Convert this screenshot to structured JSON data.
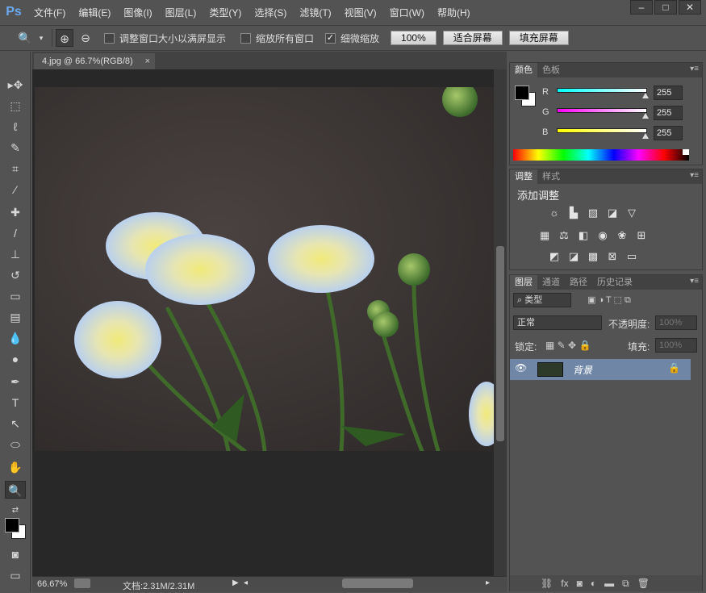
{
  "app": {
    "logo": "Ps"
  },
  "menu": [
    "文件(F)",
    "编辑(E)",
    "图像(I)",
    "图层(L)",
    "类型(Y)",
    "选择(S)",
    "滤镜(T)",
    "视图(V)",
    "窗口(W)",
    "帮助(H)"
  ],
  "options": {
    "resize_windows_label": "调整窗口大小以满屏显示",
    "zoom_all_label": "缩放所有窗口",
    "scrubby_zoom_label": "细微缩放",
    "btn_100": "100%",
    "btn_fit": "适合屏幕",
    "btn_fill": "填充屏幕"
  },
  "document": {
    "tab_title": "4.jpg @ 66.7%(RGB/8)",
    "zoom": "66.67%",
    "doc_size": "文档:2.31M/2.31M"
  },
  "color_panel": {
    "tabs": [
      "颜色",
      "色板"
    ],
    "r_label": "R",
    "g_label": "G",
    "b_label": "B",
    "r": "255",
    "g": "255",
    "b": "255"
  },
  "adjust_panel": {
    "tabs": [
      "调整",
      "样式"
    ],
    "title": "添加调整"
  },
  "layers_panel": {
    "tabs": [
      "图层",
      "通道",
      "路径",
      "历史记录"
    ],
    "filter": "类型",
    "blend_mode": "正常",
    "opacity_label": "不透明度:",
    "opacity": "100%",
    "lock_label": "锁定:",
    "fill_label": "填充:",
    "fill": "100%",
    "layer_name": "背景"
  },
  "colors": {
    "accent_blue": "#6aa9ef",
    "layer_selected": "#6f86a7"
  }
}
